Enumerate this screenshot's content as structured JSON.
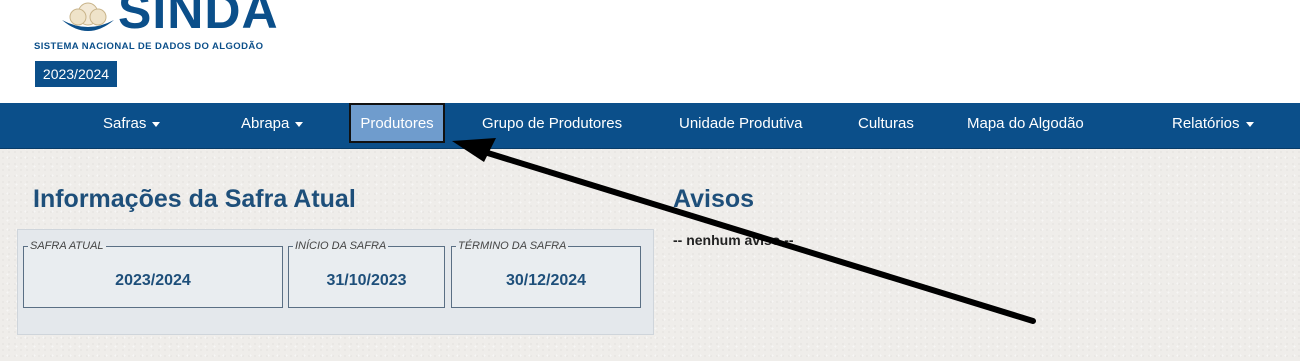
{
  "header": {
    "logo_text": "SINDA",
    "logo_subtitle": "SISTEMA NACIONAL DE DADOS DO ALGODÃO",
    "season_badge": "2023/2024"
  },
  "navbar": {
    "items": [
      {
        "label": "Safras",
        "dropdown": true
      },
      {
        "label": "Abrapa",
        "dropdown": true
      },
      {
        "label": "Produtores",
        "active": true
      },
      {
        "label": "Grupo de Produtores"
      },
      {
        "label": "Unidade Produtiva"
      },
      {
        "label": "Culturas"
      },
      {
        "label": "Mapa do Algodão"
      },
      {
        "label": "Relatórios",
        "dropdown": true
      }
    ]
  },
  "safra_info": {
    "title": "Informações da Safra Atual",
    "current": {
      "legend": "SAFRA ATUAL",
      "value": "2023/2024"
    },
    "start": {
      "legend": "INÍCIO DA SAFRA",
      "value": "31/10/2023"
    },
    "end": {
      "legend": "TÉRMINO DA SAFRA",
      "value": "30/12/2024"
    }
  },
  "notices": {
    "title": "Avisos",
    "empty_text": "-- nenhum aviso --"
  },
  "colors": {
    "brand": "#0b4f8a",
    "active_nav": "#6f9ccd",
    "title_text": "#1e4f7a",
    "content_bg": "#efedea"
  },
  "icons": [
    "cotton-flower-logo-icon",
    "caret-down-icon",
    "annotation-arrow"
  ]
}
